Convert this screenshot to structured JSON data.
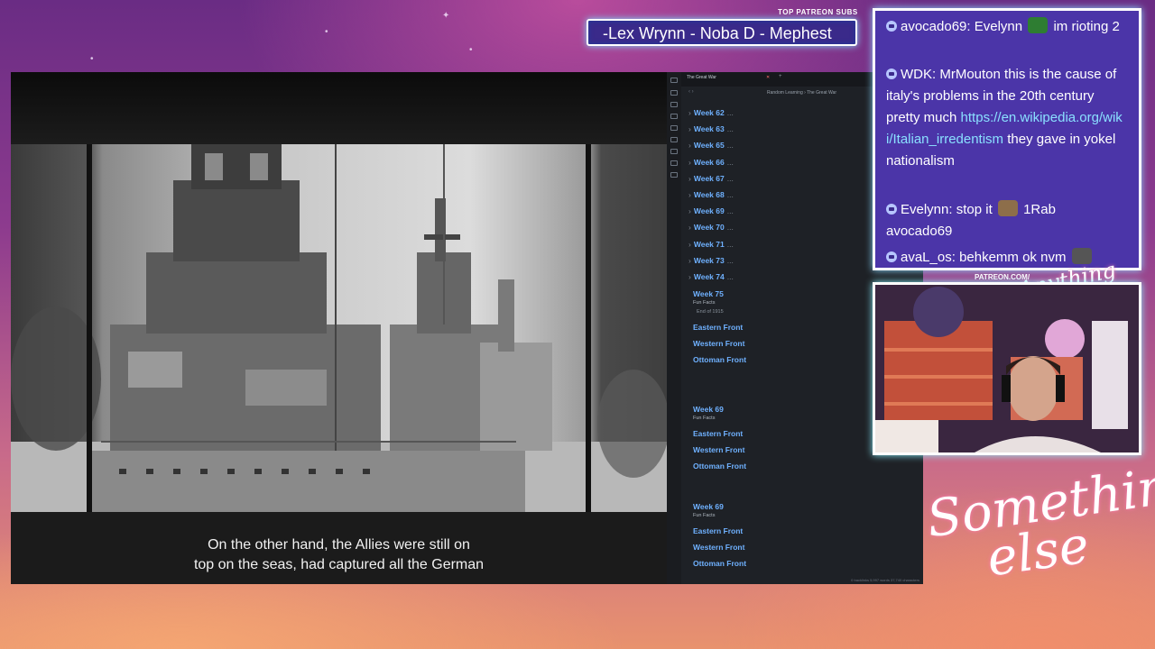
{
  "video": {
    "subtitle_lines": [
      "On the other hand, the Allies were still on",
      "top on the seas, had captured all the German"
    ]
  },
  "editor": {
    "tab_title": "The Great War",
    "breadcrumb": "Random Learning  ›  The Great War",
    "outline": [
      {
        "label": "Week 62"
      },
      {
        "label": "Week 63"
      },
      {
        "label": "Week 65"
      },
      {
        "label": "Week 66"
      },
      {
        "label": "Week 67"
      },
      {
        "label": "Week 68"
      },
      {
        "label": "Week 69"
      },
      {
        "label": "Week 70"
      },
      {
        "label": "Week 71"
      },
      {
        "label": "Week 73"
      },
      {
        "label": "Week 74"
      }
    ],
    "content": [
      {
        "heading": "Week 75",
        "sub": "Fun Facts",
        "subsub": "End of 1915"
      },
      {
        "fronts": [
          "Eastern Front",
          "Western Front",
          "Ottoman Front"
        ]
      },
      {
        "heading": "Week 69",
        "sub": "Fun Facts"
      },
      {
        "fronts": [
          "Eastern Front",
          "Western Front",
          "Ottoman Front"
        ]
      },
      {
        "heading": "Week 69",
        "sub": "Fun Facts"
      },
      {
        "fronts": [
          "Eastern Front",
          "Western Front",
          "Ottoman Front"
        ]
      }
    ],
    "status": "0 backlinks   5,997 words   37,740 characters"
  },
  "overlay": {
    "patreon_label": "TOP PATREON SUBS",
    "patreon_names": "-Lex Wrynn -  Noba D - Mephest",
    "patreon_url": "PATREON.COM/",
    "brand_small": "Anything else?",
    "brand_big_1": "Something",
    "brand_big_2": "else"
  },
  "chat": {
    "messages": [
      {
        "user": "avocado69",
        "text": "Evelynn",
        "text2": "im rioting 2"
      },
      {
        "user": "WDK",
        "text": "MrMouton this is the cause of italy's problems in the 20th century pretty much",
        "link": "https://en.wikipedia.org/wiki/Italian_irredentism",
        "text2": "they gave in yokel nationalism"
      },
      {
        "user": "Evelynn",
        "text": "stop it",
        "text2": "1Rab avocado69"
      },
      {
        "user": "avaL_os",
        "text": "behkemm ok nvm"
      }
    ]
  },
  "colors": {
    "chat_bg": "#4b35a8",
    "accent_link": "#8ae0ff",
    "editor_heading": "#6fb1ff"
  }
}
